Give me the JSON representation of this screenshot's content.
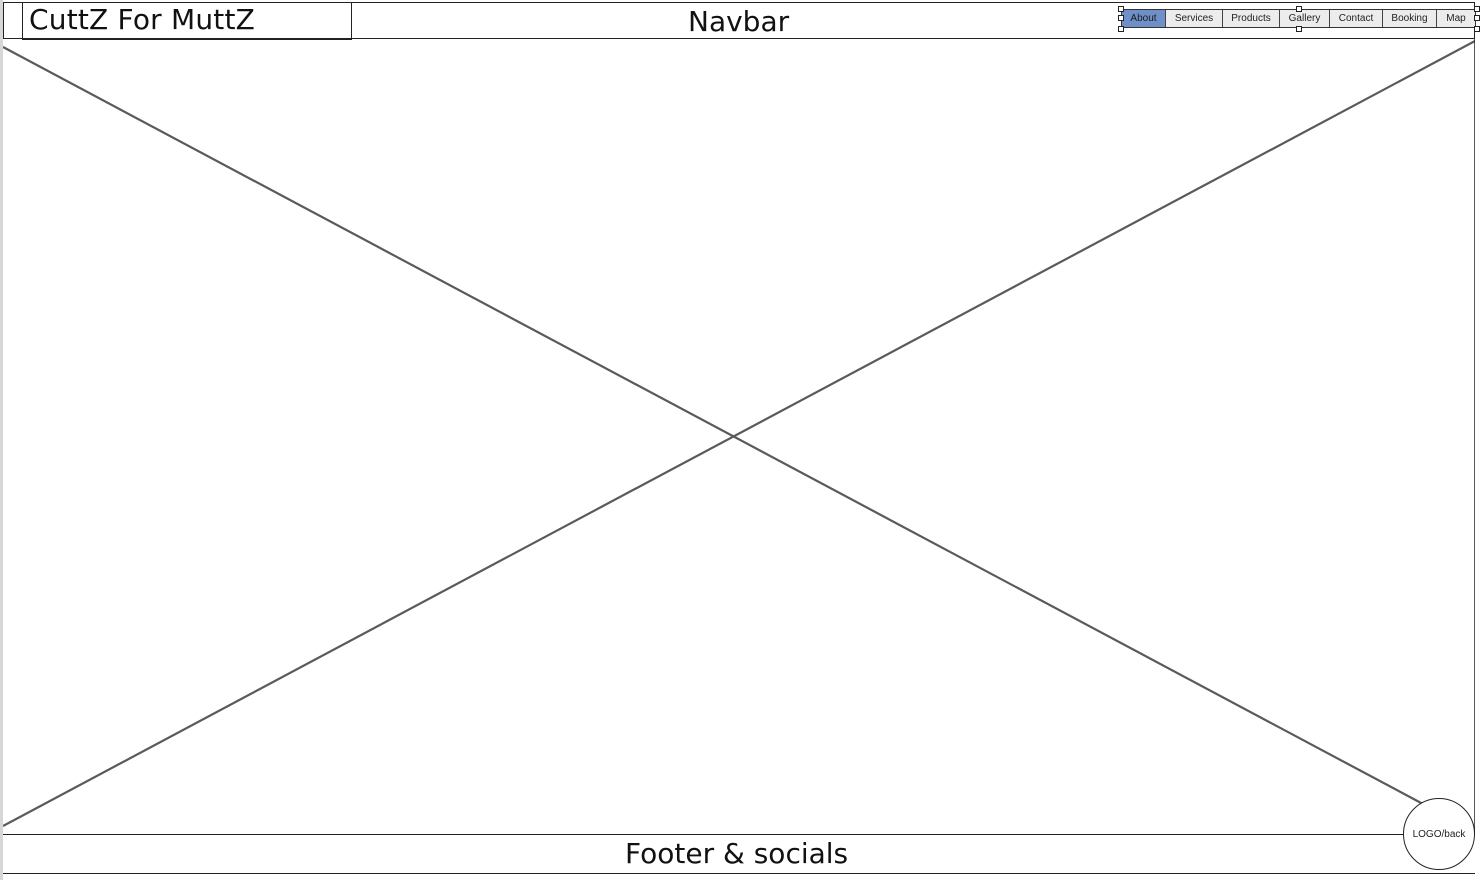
{
  "brand": {
    "name": "CuttZ For MuttZ"
  },
  "navbar": {
    "title": "Navbar",
    "tabs": [
      {
        "label": "About",
        "active": true
      },
      {
        "label": "Services",
        "active": false
      },
      {
        "label": "Products",
        "active": false
      },
      {
        "label": "Gallery",
        "active": false
      },
      {
        "label": "Contact",
        "active": false
      },
      {
        "label": "Booking",
        "active": false
      },
      {
        "label": "Map",
        "active": false
      }
    ]
  },
  "hero": {
    "icon": "image-placeholder-icon"
  },
  "footer": {
    "text": "Footer & socials"
  },
  "back_button": {
    "label": "LOGO/back"
  },
  "colors": {
    "active_tab": "#6f8fc9",
    "border": "#222222",
    "placeholder_line": "#5a5a5a"
  }
}
